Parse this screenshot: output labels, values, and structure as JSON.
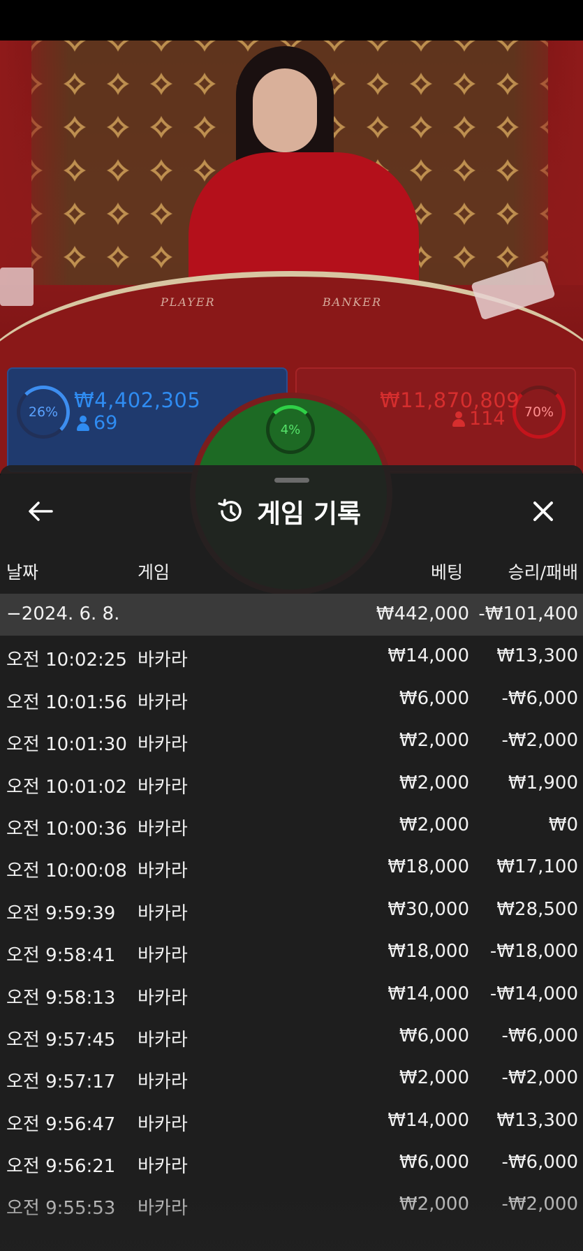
{
  "video": {
    "table_label_player": "PLAYER",
    "table_label_banker": "BANKER"
  },
  "bet_panels": {
    "player": {
      "percent": "26%",
      "amount": "₩4,402,305",
      "players": "69",
      "color": "#2f8cf2"
    },
    "banker": {
      "percent": "70%",
      "amount": "₩11,870,809",
      "players": "114",
      "color": "#d62e2e"
    },
    "tie": {
      "percent": "4%",
      "color": "#56e36a"
    }
  },
  "sheet": {
    "title": "게임 기록",
    "title_icon": "history-icon",
    "back_icon": "arrow-left-icon",
    "close_icon": "close-icon",
    "columns": {
      "date": "날짜",
      "game": "게임",
      "bet": "베팅",
      "result": "승리/패배"
    },
    "summary": {
      "date": "−2024. 6. 8.",
      "bet": "₩442,000",
      "result": "-₩101,400"
    },
    "rows": [
      {
        "time": "오전 10:02:25",
        "game": "바카라",
        "bet": "₩14,000",
        "result": "₩13,300"
      },
      {
        "time": "오전 10:01:56",
        "game": "바카라",
        "bet": "₩6,000",
        "result": "-₩6,000"
      },
      {
        "time": "오전 10:01:30",
        "game": "바카라",
        "bet": "₩2,000",
        "result": "-₩2,000"
      },
      {
        "time": "오전 10:01:02",
        "game": "바카라",
        "bet": "₩2,000",
        "result": "₩1,900"
      },
      {
        "time": "오전 10:00:36",
        "game": "바카라",
        "bet": "₩2,000",
        "result": "₩0"
      },
      {
        "time": "오전 10:00:08",
        "game": "바카라",
        "bet": "₩18,000",
        "result": "₩17,100"
      },
      {
        "time": "오전 9:59:39",
        "game": "바카라",
        "bet": "₩30,000",
        "result": "₩28,500"
      },
      {
        "time": "오전 9:58:41",
        "game": "바카라",
        "bet": "₩18,000",
        "result": "-₩18,000"
      },
      {
        "time": "오전 9:58:13",
        "game": "바카라",
        "bet": "₩14,000",
        "result": "-₩14,000"
      },
      {
        "time": "오전 9:57:45",
        "game": "바카라",
        "bet": "₩6,000",
        "result": "-₩6,000"
      },
      {
        "time": "오전 9:57:17",
        "game": "바카라",
        "bet": "₩2,000",
        "result": "-₩2,000"
      },
      {
        "time": "오전 9:56:47",
        "game": "바카라",
        "bet": "₩14,000",
        "result": "₩13,300"
      },
      {
        "time": "오전 9:56:21",
        "game": "바카라",
        "bet": "₩6,000",
        "result": "-₩6,000"
      },
      {
        "time": "오전 9:55:53",
        "game": "바카라",
        "bet": "₩2,000",
        "result": "-₩2,000"
      }
    ]
  }
}
